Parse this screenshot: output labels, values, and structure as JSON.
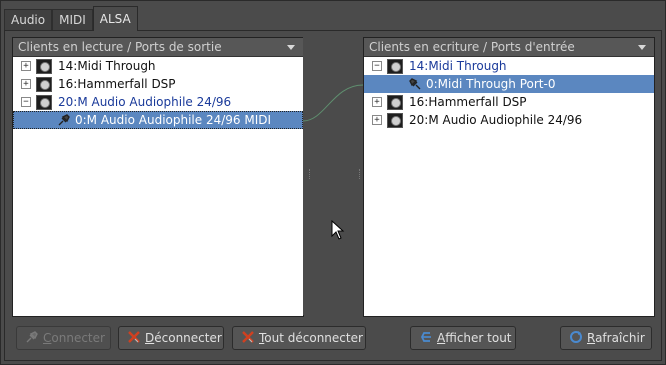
{
  "tabs": [
    {
      "label": "Audio",
      "active": false
    },
    {
      "label": "MIDI",
      "active": false
    },
    {
      "label": "ALSA",
      "active": true
    }
  ],
  "left_panel": {
    "header": "Clients en lecture / Ports de sortie",
    "clients": [
      {
        "expander": "+",
        "label": "14:Midi Through"
      },
      {
        "expander": "+",
        "label": "16:Hammerfall DSP"
      },
      {
        "expander": "−",
        "label": "20:M Audio Audiophile 24/96"
      }
    ],
    "ports": [
      {
        "label": "0:M Audio Audiophile 24/96 MIDI",
        "selected": true
      }
    ]
  },
  "right_panel": {
    "header": "Clients en ecriture / Ports d'entrée",
    "clients": [
      {
        "expander": "−",
        "label": "14:Midi Through"
      },
      {
        "expander": "+",
        "label": "16:Hammerfall DSP"
      },
      {
        "expander": "+",
        "label": "20:M Audio Audiophile 24/96"
      }
    ],
    "ports": [
      {
        "label": "0:Midi Through Port-0",
        "selected": true
      }
    ]
  },
  "buttons": {
    "connect": {
      "first": "C",
      "rest": "onnecter",
      "enabled": false
    },
    "disconnect": {
      "first": "D",
      "rest": "éconnecter",
      "enabled": true
    },
    "disconnect_all": {
      "first": "T",
      "rest": "out déconnecter",
      "enabled": true
    },
    "show_all": {
      "first": "A",
      "rest": "fficher tout",
      "enabled": true
    },
    "refresh": {
      "first": "R",
      "rest": "afraîchir",
      "enabled": true
    }
  },
  "icons": {
    "client": "midi-device-icon",
    "port": "midi-plug-icon",
    "connect": "connect-plug-icon",
    "disconnect": "disconnect-x-icon",
    "disconnect_all": "disconnect-all-x-icon",
    "show_all": "show-all-icon",
    "refresh": "refresh-icon"
  },
  "colors": {
    "selection": "#5b87c0",
    "client_blue": "#1a3a9a",
    "wire": "#5f8f6f"
  }
}
